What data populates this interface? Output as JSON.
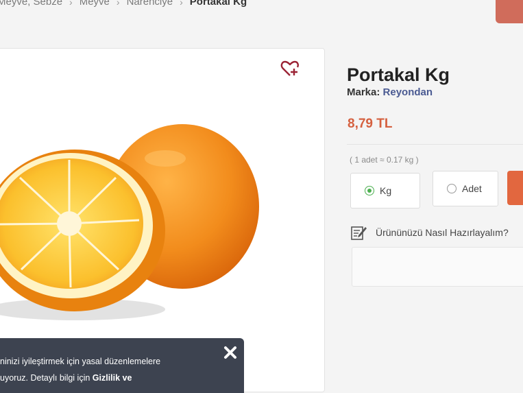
{
  "breadcrumb": {
    "items": [
      "Meyve, Sebze",
      "Meyve",
      "Narenciye",
      "Portakal Kg"
    ]
  },
  "product": {
    "title": "Portakal Kg",
    "brand_label": "Marka:",
    "brand_name": "Reyondan",
    "price": "8,79 TL",
    "unit_note": "( 1 adet ≈ 0.17 kg )",
    "unit_options": [
      {
        "label": "Kg",
        "selected": true
      },
      {
        "label": "Adet",
        "selected": false
      }
    ],
    "prep_label": "Ürününüzü Nasıl Hazırlayalım?"
  },
  "cookie_banner": {
    "line1": "ninizi iyileştirmek için yasal düzenlemelere",
    "line2_prefix": "uyoruz. Detaylı bilgi için ",
    "line2_link": "Gizlilik ve"
  },
  "icons": {
    "favorite": "heart-plus-icon",
    "close": "close-icon",
    "prep": "edit-note-icon",
    "separator": "chevron-right-icon"
  },
  "colors": {
    "price": "#d5603f",
    "brand_link": "#4a5a92",
    "accent_orange": "#e2673f",
    "radio_selected": "#4caf50",
    "favorite_icon": "#9b2335",
    "banner_bg": "#3d4350"
  }
}
